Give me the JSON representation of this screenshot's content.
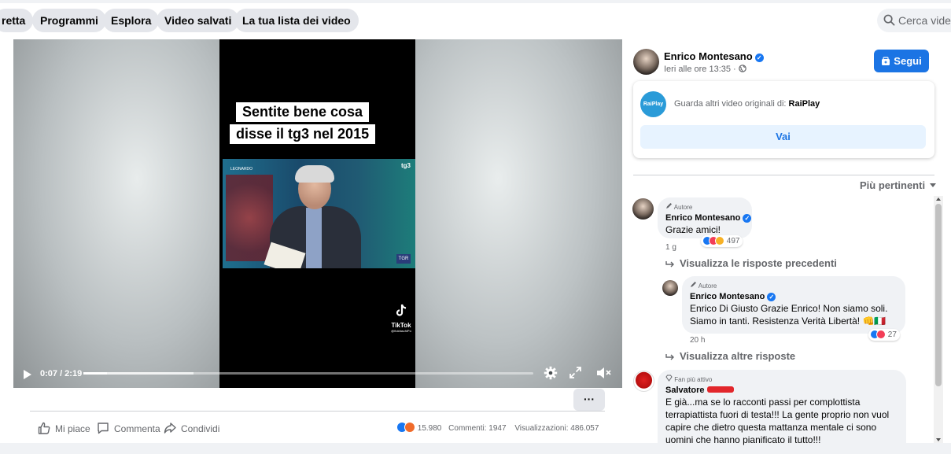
{
  "tabs": {
    "items": [
      "retta",
      "Programmi",
      "Esplora",
      "Video salvati",
      "La tua lista dei video"
    ],
    "search_placeholder": "Cerca video"
  },
  "video": {
    "caption_line1": "Sentite bene cosa",
    "caption_line2": "disse il tg3 nel 2015",
    "tv_logo_left": "LEONARDO",
    "tv_logo_right": "tg3",
    "tv_corner": "TGR",
    "tiktok_name": "TikTok",
    "tiktok_handle": "@fiokfaschiPo",
    "time": "0:07 / 2:19",
    "progress": 0.052,
    "buffered": 0.245
  },
  "post": {
    "more_label": "···",
    "like_label": "Mi piace",
    "comment_label": "Commenta",
    "share_label": "Condividi",
    "reactions_count": "15.980",
    "comments_count": "Commenti: 1947",
    "views_count": "Visualizzazioni: 486.057"
  },
  "sidebar": {
    "author_name": "Enrico Montesano",
    "posted_time": "Ieri alle ore 13:35 ·",
    "follow_label": "Segui",
    "rai_logo": "RaiPlay",
    "rai_text": "Guarda altri video originali di:",
    "rai_name": "RaiPlay",
    "rai_button": "Vai",
    "sort_label": "Più pertinenti"
  },
  "comments": {
    "c1": {
      "badge": "Autore",
      "name": "Enrico Montesano",
      "text": "Grazie amici!",
      "reactions": "497",
      "time": "1 g"
    },
    "prev_replies": "Visualizza le risposte precedenti",
    "c2": {
      "badge": "Autore",
      "name": "Enrico Montesano",
      "text": "Enrico Di Giusto Grazie Enrico! Non siamo soli. Siamo in tanti. Resistenza Verità Libertà! 👊🇮🇹",
      "reactions": "27",
      "time": "20 h"
    },
    "more_replies": "Visualizza altre risposte",
    "c3": {
      "badge": "Fan più attivo",
      "name": "Salvatore",
      "text": "E già...ma se lo racconti passi per complottista terrapiattista fuori di testa!!! La gente proprio non vuol capire che dietro questa mattanza mentale ci sono uomini che hanno pianificato il tutto!!!"
    }
  },
  "colors": {
    "accent": "#1b74e4",
    "chip": "#e4e6eb",
    "bubble": "#f0f2f5"
  }
}
